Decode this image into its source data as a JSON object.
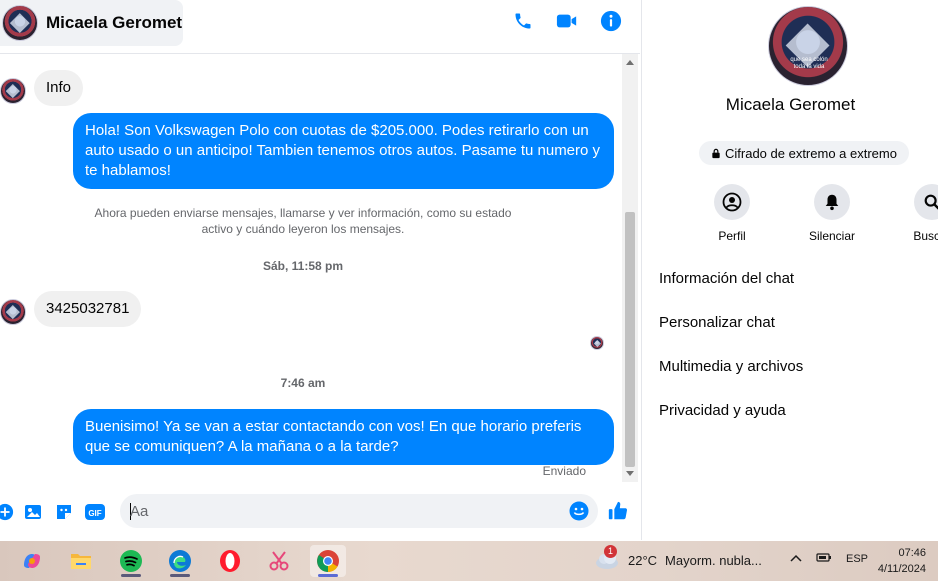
{
  "colors": {
    "accent": "#0084ff",
    "bubble_in": "#f0f0f0"
  },
  "chat": {
    "contact_name": "Micaela Geromet",
    "actions": [
      "phone-icon",
      "video-icon",
      "info-icon"
    ]
  },
  "messages": {
    "in1": "Info",
    "out1": "Hola! Son Volkswagen Polo con cuotas de $205.000. Podes retirarlo con un auto usado o un anticipo! Tambien tenemos otros autos. Pasame tu numero y te hablamos!",
    "system_note": "Ahora pueden enviarse mensajes, llamarse y ver información, como su estado activo y cuándo leyeron los mensajes.",
    "time1": "Sáb, 11:58 pm",
    "in2": "3425032781",
    "time2": "7:46 am",
    "out2": "Buenisimo! Ya se van a estar contactando con vos! En que horario preferis que se comuniquen? A la mañana o a la tarde?",
    "status": "Enviado"
  },
  "composer": {
    "placeholder": "Aa"
  },
  "panel": {
    "name": "Micaela Geromet",
    "avatar_caption_1": "que sea colón",
    "avatar_caption_2": "toda la vida",
    "encryption": "Cifrado de extremo a extremo",
    "quick_actions": {
      "profile": "Perfil",
      "mute": "Silenciar",
      "search": "Buscar"
    },
    "menu": {
      "chat_info": "Información del chat",
      "customize": "Personalizar chat",
      "media": "Multimedia y archivos",
      "privacy": "Privacidad y ayuda"
    }
  },
  "taskbar": {
    "weather_badge": "1",
    "temperature": "22°C",
    "weather_text": "Mayorm. nubla...",
    "language": "ESP",
    "time": "07:46",
    "date": "4/11/2024"
  }
}
